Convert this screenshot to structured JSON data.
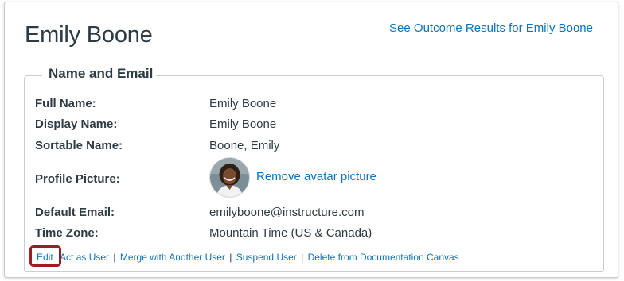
{
  "user": {
    "name": "Emily Boone"
  },
  "header": {
    "outcome_link": "See Outcome Results for Emily Boone"
  },
  "section": {
    "legend": "Name and Email",
    "fields": {
      "full_name": {
        "label": "Full Name:",
        "value": "Emily Boone"
      },
      "display_name": {
        "label": "Display Name:",
        "value": "Emily Boone"
      },
      "sortable_name": {
        "label": "Sortable Name:",
        "value": "Boone, Emily"
      },
      "profile_picture": {
        "label": "Profile Picture:",
        "action": "Remove avatar picture"
      },
      "default_email": {
        "label": "Default Email:",
        "value": "emilyboone@instructure.com"
      },
      "time_zone": {
        "label": "Time Zone:",
        "value": "Mountain Time (US & Canada)"
      }
    }
  },
  "actions": {
    "edit": "Edit",
    "act_as_user": "Act as User",
    "merge": "Merge with Another User",
    "suspend": "Suspend User",
    "delete": "Delete from Documentation Canvas",
    "separator": "|"
  },
  "colors": {
    "text": "#2d3b45",
    "link": "#0b74bc",
    "highlight": "#9c1d22",
    "border": "#c7cdd1"
  }
}
